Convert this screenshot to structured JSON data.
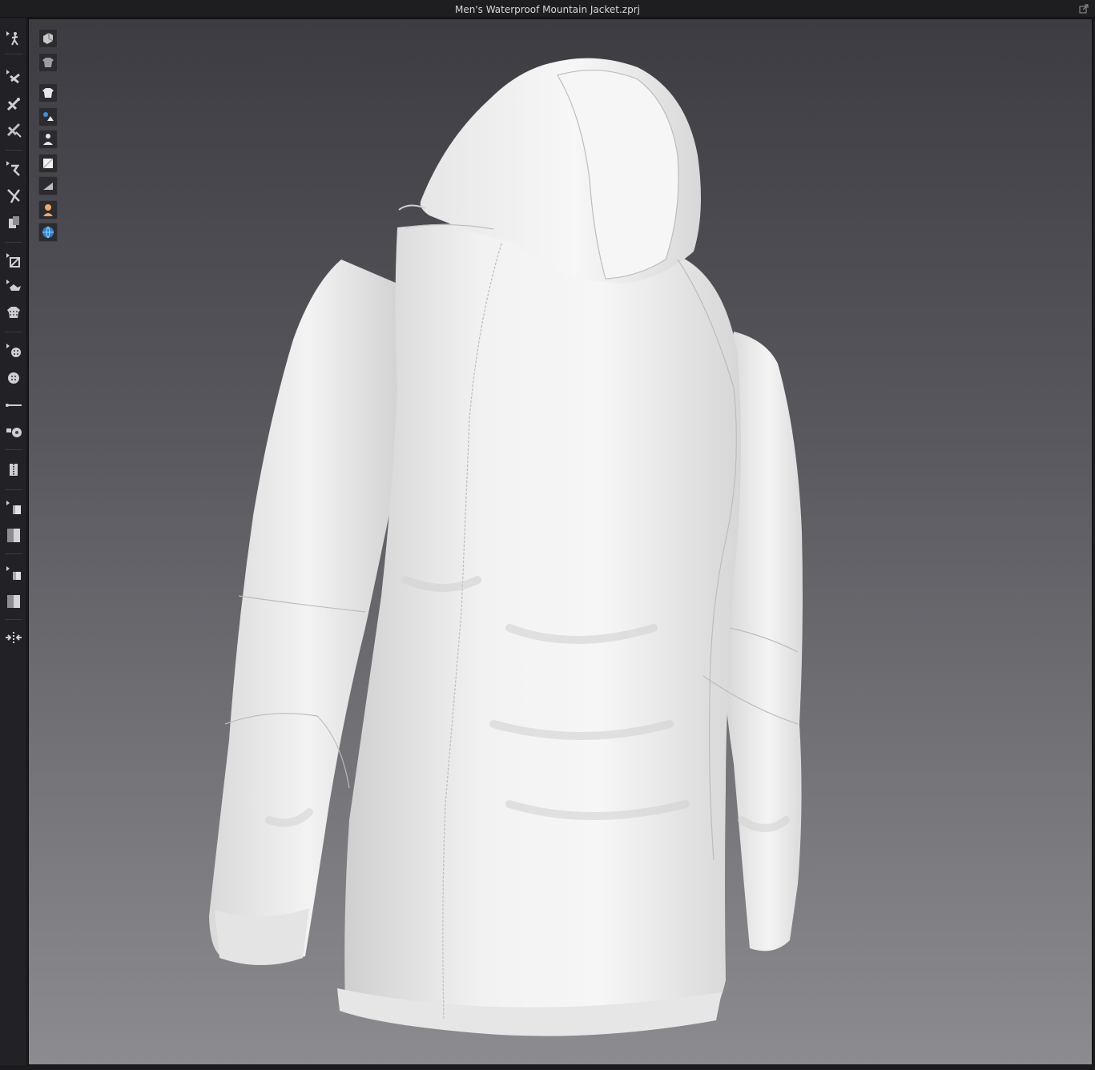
{
  "window": {
    "title": "Men's Waterproof Mountain Jacket.zprj",
    "popout_icon": "popout-icon"
  },
  "left_toolbar": {
    "tools": [
      {
        "icon": "avatar-pose-icon"
      },
      {
        "icon": "select-move-icon"
      },
      {
        "icon": "transform-pattern-icon"
      },
      {
        "icon": "edit-pattern-icon"
      },
      {
        "icon": "segment-sewing-icon"
      },
      {
        "icon": "free-sewing-icon"
      },
      {
        "icon": "tack-icon"
      },
      {
        "icon": "pin-icon"
      },
      {
        "icon": "fold-arrangement-icon"
      },
      {
        "icon": "texture-transform-icon"
      },
      {
        "icon": "button-tool-icon"
      },
      {
        "icon": "buttonhole-icon"
      },
      {
        "icon": "measure-line-icon"
      },
      {
        "icon": "lock-button-icon"
      },
      {
        "icon": "zipper-icon"
      },
      {
        "icon": "graphic-select-icon"
      },
      {
        "icon": "graphic-transform-icon"
      },
      {
        "icon": "trim-select-icon"
      },
      {
        "icon": "trim-transform-icon"
      },
      {
        "icon": "puckering-icon"
      }
    ]
  },
  "view_toolbar": {
    "buttons": [
      {
        "icon": "show-3d-garment-icon"
      },
      {
        "icon": "show-texture-icon"
      },
      {
        "icon": "garment-surface-icon"
      },
      {
        "icon": "show-pins-icon"
      },
      {
        "icon": "show-avatar-icon"
      },
      {
        "icon": "thick-textured-surface-icon"
      },
      {
        "icon": "show-normal-map-icon"
      },
      {
        "icon": "avatar-skin-icon"
      },
      {
        "icon": "environment-globe-icon"
      }
    ]
  },
  "colors": {
    "background": "#1b1b1e",
    "toolbar": "#222226",
    "viewport_top": "#3c3c42",
    "viewport_bottom": "#8c8c90",
    "garment": "#eeeeee"
  }
}
